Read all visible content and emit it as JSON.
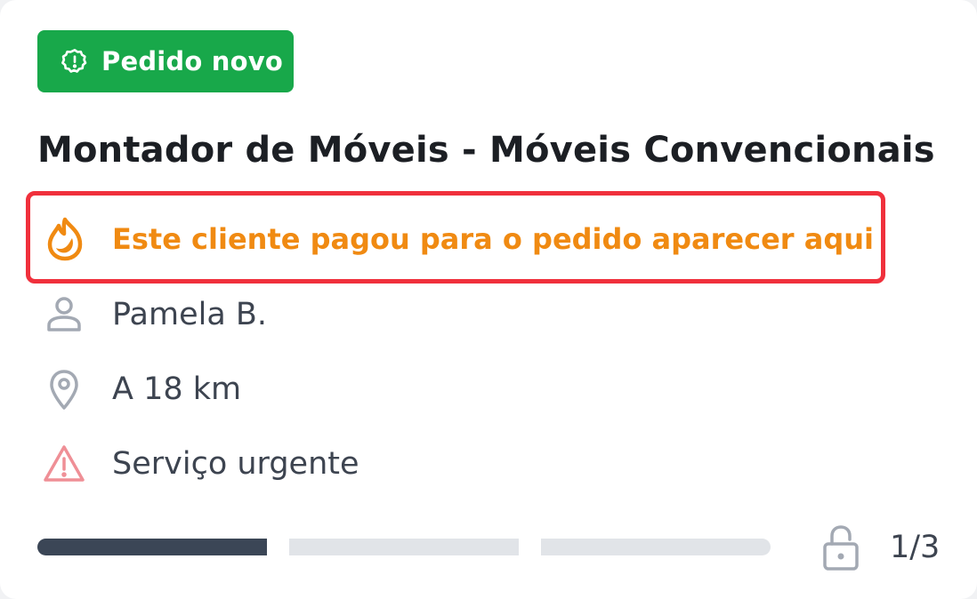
{
  "badge": {
    "label": "Pedido novo",
    "icon": "alert-badge-icon",
    "color": "#18a84a"
  },
  "title": "Montador de Móveis - Móveis Convencionais",
  "promo": {
    "text": "Este cliente pagou para o pedido aparecer aqui",
    "icon": "flame-icon",
    "color": "#f08a12",
    "highlight_color": "#f0303c"
  },
  "details": {
    "client_name": "Pamela B.",
    "distance": "A 18 km",
    "urgency": "Serviço urgente"
  },
  "progress": {
    "current": 1,
    "total": 3,
    "label": "1/3",
    "filled_color": "#3b4656",
    "empty_color": "#e1e4e8"
  }
}
